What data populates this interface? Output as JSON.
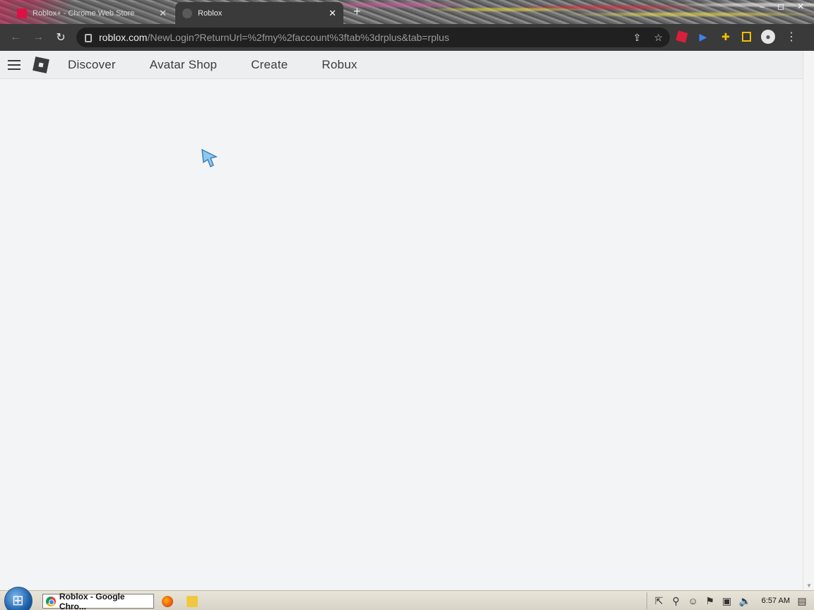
{
  "browser": {
    "tabs": [
      {
        "title": "Roblox+ - Chrome Web Store",
        "active": false
      },
      {
        "title": "Roblox",
        "active": true
      }
    ],
    "new_tab_symbol": "+",
    "window_controls": [
      "–",
      "◻",
      "✕"
    ],
    "url_host": "roblox.com",
    "url_path": "/NewLogin?ReturnUrl=%2fmy%2faccount%3ftab%3drplus&tab=rplus",
    "nav_icons": {
      "back": "←",
      "forward": "→",
      "reload": "↻"
    }
  },
  "site": {
    "nav": [
      "Discover",
      "Avatar Shop",
      "Create",
      "Robux"
    ]
  },
  "taskbar": {
    "window_label": "Roblox - Google Chro...",
    "clock": "6:57 AM"
  }
}
